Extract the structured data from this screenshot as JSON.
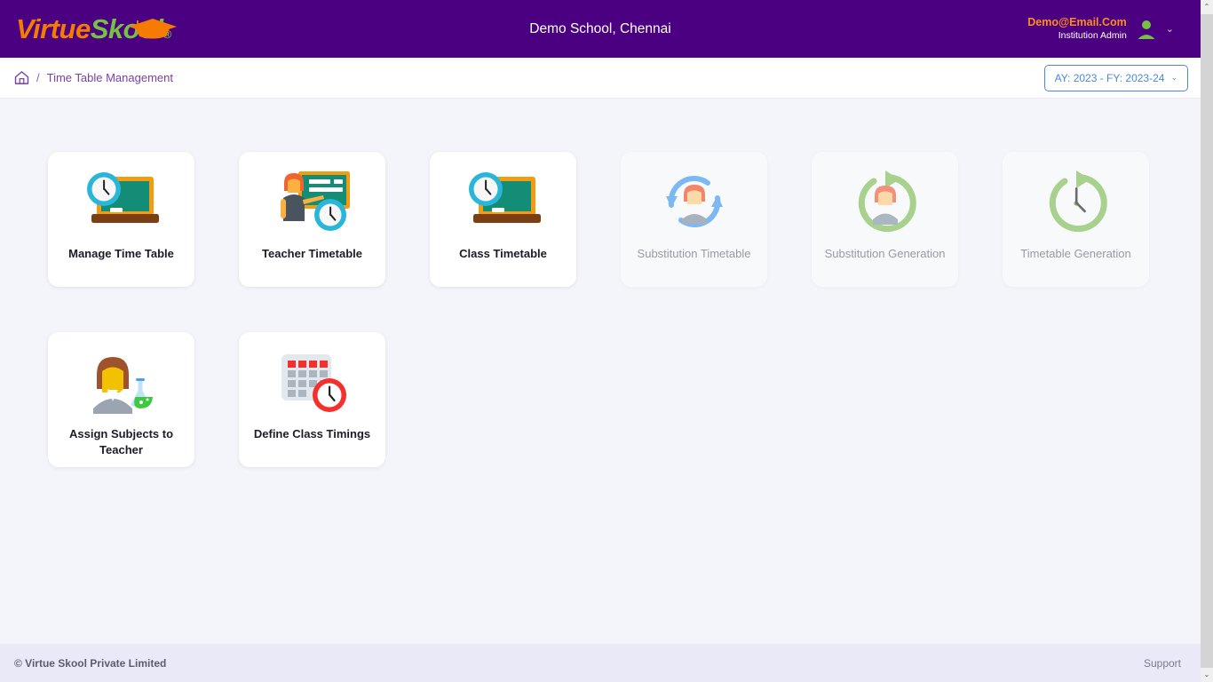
{
  "header": {
    "logo": {
      "part1": "Virtue",
      "part2": "Skool",
      "registered": "®",
      "icon": "graduation-cap-icon"
    },
    "school_title": "Demo School, Chennai",
    "user": {
      "email": "Demo@Email.Com",
      "role": "Institution Admin",
      "avatar_icon": "user-avatar-icon",
      "caret_icon": "chevron-down-icon"
    },
    "colors": {
      "bar": "#4b0082",
      "email": "#ff8c1a",
      "logo_orange": "#f57c00",
      "logo_green": "#76c043"
    }
  },
  "breadcrumb": {
    "home_icon": "home-icon",
    "separator": "/",
    "current": "Time Table Management"
  },
  "academic_year": {
    "label": "AY: 2023 - FY: 2023-24",
    "caret_icon": "chevron-down-icon",
    "accent": "#4a88e0"
  },
  "cards": [
    {
      "label": "Manage Time Table",
      "icon": "chalkboard-clock-icon",
      "enabled": true
    },
    {
      "label": "Teacher Timetable",
      "icon": "teacher-board-clock-icon",
      "enabled": true
    },
    {
      "label": "Class Timetable",
      "icon": "chalkboard-clock-icon",
      "enabled": true
    },
    {
      "label": "Substitution Timetable",
      "icon": "person-sync-blue-icon",
      "enabled": false
    },
    {
      "label": "Substitution Generation",
      "icon": "person-refresh-green-icon",
      "enabled": false
    },
    {
      "label": "Timetable Generation",
      "icon": "clock-refresh-green-icon",
      "enabled": false
    },
    {
      "label": "Assign Subjects to Teacher",
      "icon": "teacher-flask-icon",
      "enabled": true
    },
    {
      "label": "Define Class Timings",
      "icon": "calendar-clock-icon",
      "enabled": true
    }
  ],
  "footer": {
    "copyright": "© Virtue Skool Private Limited",
    "support": "Support"
  },
  "scrollbar": {
    "up_arrow": "⌃",
    "down_arrow": "⌄"
  }
}
